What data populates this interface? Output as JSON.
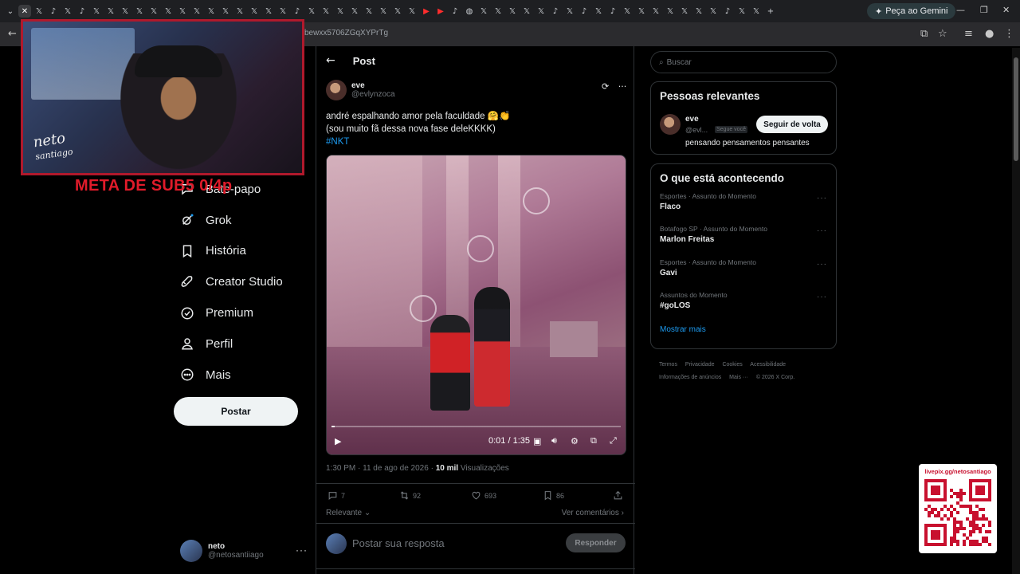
{
  "browser": {
    "gemini_label": "Peça ao Gemini",
    "url": "bewxx5706ZGqXYPrTg"
  },
  "overlay": {
    "meta_text": "META DE SUB5 0/4p",
    "cam_logo_line1": "neto",
    "cam_logo_line2": "santiago",
    "qr_url": "livepix.gg/netosantiago"
  },
  "nav": {
    "items": [
      {
        "label": "Bate-papo",
        "icon": "chat-icon"
      },
      {
        "label": "Grok",
        "icon": "grok-icon"
      },
      {
        "label": "História",
        "icon": "bookmark-icon"
      },
      {
        "label": "Creator Studio",
        "icon": "rocket-icon"
      },
      {
        "label": "Premium",
        "icon": "verified-icon"
      },
      {
        "label": "Perfil",
        "icon": "profile-icon"
      },
      {
        "label": "Mais",
        "icon": "more-circle-icon"
      }
    ],
    "post_button": "Postar",
    "me": {
      "name": "neto",
      "handle": "@netosantiiago"
    }
  },
  "post": {
    "header_title": "Post",
    "author_name": "eve",
    "author_handle": "@evlynzoca",
    "text_line1": "andré espalhando amor pela faculdade 🤗👏",
    "text_line2": "(sou muito fã dessa nova fase deleKKKK)",
    "hashtag": "#NKT",
    "video": {
      "time": "0:01 / 1:35",
      "progress": 0.01
    },
    "timestamp": "1:30 PM · 11 de ago de 2026 ·",
    "views_count": "10 mil",
    "views_label": "Visualizações",
    "stats": {
      "replies": "7",
      "reposts": "92",
      "likes": "693",
      "bookmarks": "86"
    },
    "relevant_label": "Relevante",
    "view_comments": "Ver comentários",
    "reply_placeholder": "Postar sua resposta",
    "reply_button": "Responder"
  },
  "sidebar": {
    "search_placeholder": "Buscar",
    "relevant": {
      "title": "Pessoas relevantes",
      "name": "eve",
      "handle": "@evl...",
      "badge": "Segue você",
      "follow_button": "Seguir de volta",
      "bio": "pensando pensamentos pensantes"
    },
    "trends": {
      "title": "O que está acontecendo",
      "items": [
        {
          "category": "Esportes · Assunto do Momento",
          "name": "Flaco"
        },
        {
          "category": "Botafogo SP · Assunto do Momento",
          "name": "Marlon Freitas"
        },
        {
          "category": "Esportes · Assunto do Momento",
          "name": "Gavi"
        },
        {
          "category": "Assuntos do Momento",
          "name": "#goLOS"
        }
      ],
      "show_more": "Mostrar mais"
    },
    "footer": [
      "Termos",
      "Privacidade",
      "Cookies",
      "Acessibilidade",
      "Informações de anúncios",
      "Mais ···",
      "© 2026 X Corp."
    ]
  }
}
